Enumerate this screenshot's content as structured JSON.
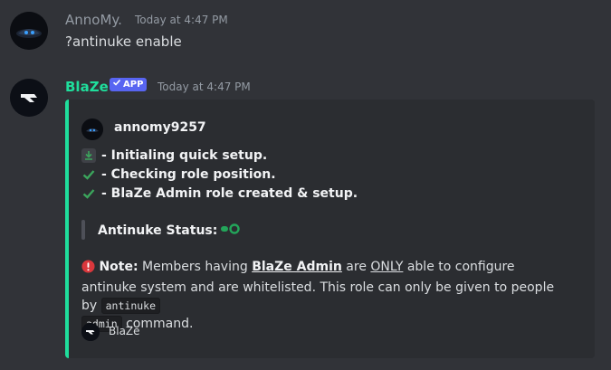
{
  "messages": [
    {
      "author": "AnnoMy.",
      "timestamp": "Today at 4:47 PM",
      "content": "?antinuke enable",
      "author_color": "#949ba4"
    },
    {
      "author": "BlaZe",
      "badge": "APP",
      "timestamp": "Today at 4:47 PM",
      "author_color": "#1fde9c",
      "embed": {
        "accent_color": "#1fde9c",
        "author": "annomy9257",
        "steps": [
          {
            "icon": "download-icon",
            "text": "- Initialing quick setup."
          },
          {
            "icon": "check-icon",
            "text": "- Checking role position."
          },
          {
            "icon": "check-icon",
            "text": "- BlaZe Admin role created & setup."
          }
        ],
        "status_label": "Antinuke Status:",
        "status_icon": "toggle-on-icon",
        "note": {
          "label": "Note:",
          "t1": " Members having ",
          "role": "BlaZe Admin",
          "t2": " are ",
          "only": "ONLY",
          "t3": " able to configure antinuke system and are whitelisted. This role can only be given to people by ",
          "code1": "antinuke",
          "code2": "admin",
          "t4": " command."
        },
        "footer": "BlaZe"
      }
    }
  ]
}
